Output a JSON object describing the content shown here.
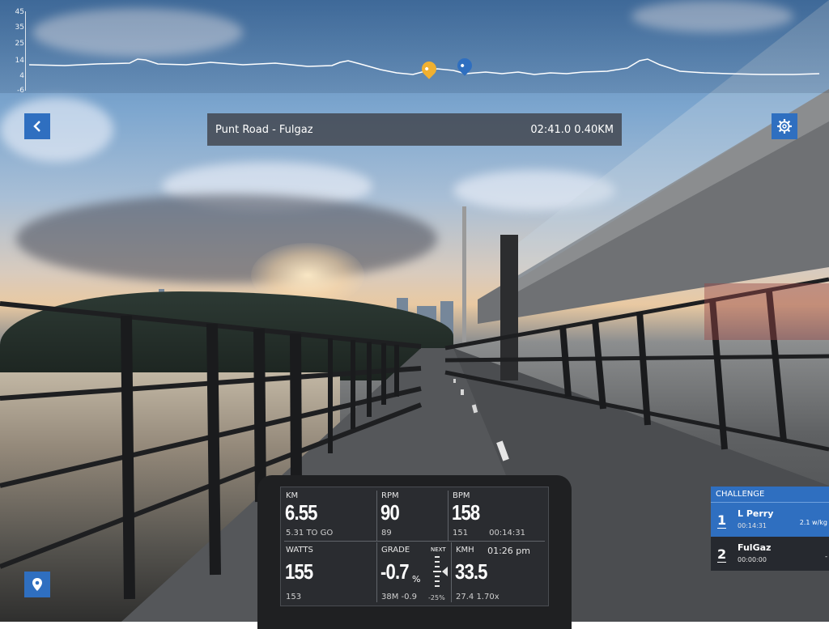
{
  "elevation": {
    "ticks": [
      "45",
      "35",
      "25",
      "14",
      "4",
      "-6"
    ]
  },
  "route": {
    "title": "Punt Road - Fulgaz",
    "time_distance": "02:41.0 0.40KM"
  },
  "icons": {
    "back": "chevron-left-icon",
    "settings": "gear-icon",
    "map": "map-pin-icon"
  },
  "colors": {
    "accent": "#2f6fc0",
    "marker_rider": "#f0b030",
    "marker_opponent": "#2f6fc0"
  },
  "dashboard": {
    "km": {
      "label": "KM",
      "value": "6.55",
      "sub": "5.31 TO GO"
    },
    "rpm": {
      "label": "RPM",
      "value": "90",
      "sub": "89"
    },
    "bpm": {
      "label": "BPM",
      "value": "158",
      "sub_left": "151",
      "sub_right": "00:14:31"
    },
    "watts": {
      "label": "WATTS",
      "value": "155",
      "sub": "153"
    },
    "grade": {
      "label": "GRADE",
      "value": "-0.7",
      "unit": "%",
      "sub": "38M -0.9"
    },
    "next": {
      "label": "NEXT",
      "value": "-25%"
    },
    "kmh": {
      "label": "KMH",
      "clock": "01:26 pm",
      "value": "33.5",
      "sub": "27.4 1.70x"
    }
  },
  "challenge": {
    "title": "CHALLENGE",
    "entries": [
      {
        "rank": "1",
        "name": "L Perry",
        "time": "00:14:31",
        "wkg": "2.1 w/kg"
      },
      {
        "rank": "2",
        "name": "FulGaz",
        "time": "00:00:00",
        "wkg": "-"
      }
    ]
  }
}
